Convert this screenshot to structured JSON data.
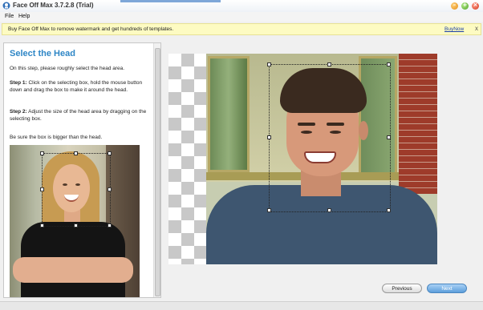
{
  "window": {
    "title": "Face Off Max  3.7.2.8  (Trial)",
    "controls": [
      "minimize",
      "maximize",
      "close"
    ]
  },
  "menu": {
    "items": [
      "File",
      "Help"
    ]
  },
  "banner": {
    "message": "Buy Face Off Max to remove watermark and get hundreds of templates.",
    "link": "BuyNow",
    "close": "x"
  },
  "instructions": {
    "heading": "Select the Head",
    "intro": "On this step, please roughly select the head area.",
    "step1_label": "Step 1:",
    "step1_text": " Click on the selecting box, hold the mouse button down and drag the box to make it around the head.",
    "step2_label": "Step 2:",
    "step2_text": " Adjust the size of the head area by dragging on the selecting box.",
    "note": "Be sure the box is bigger than the head."
  },
  "buttons": {
    "previous": "Previous",
    "next": "Next"
  },
  "colors": {
    "heading": "#2e86c6",
    "banner_bg": "#fdfbc2",
    "link": "#1a3fa8",
    "next_button": "#5c9fdb"
  },
  "icons": [
    "app-icon",
    "minimize-icon",
    "maximize-icon",
    "close-icon",
    "banner-close-icon"
  ]
}
